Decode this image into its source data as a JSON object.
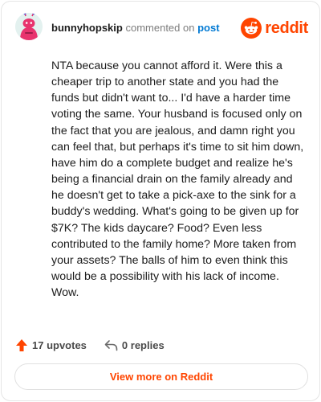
{
  "header": {
    "username": "bunnyhopskip",
    "action_text": "commented on",
    "post_link": "post",
    "logo_text": "reddit"
  },
  "comment": {
    "body": "NTA because you cannot afford it. Were this a cheaper trip to another state and you had the funds but didn't want to... I'd have a harder time voting the same. Your husband is focused only on the fact that you are jealous, and damn right you can feel that, but perhaps it's time to sit him down, have him do a complete budget and realize he's being a financial drain on the family already and he doesn't get to take a pick-axe to the sink for a buddy's wedding. What's going to be given up for $7K? The kids daycare? Food? Even less contributed to the family home? More taken from your assets? The balls of him to even think this would be a possibility with his lack of income. Wow."
  },
  "stats": {
    "upvotes": "17 upvotes",
    "replies": "0 replies"
  },
  "footer": {
    "view_more_label": "View more on Reddit"
  },
  "icons": {
    "avatar": "snoo-avatar-icon",
    "logo": "reddit-logo-icon",
    "upvote": "upvote-arrow-icon",
    "reply": "reply-arrow-icon"
  },
  "colors": {
    "brand": "#ff4500",
    "link": "#0079d3",
    "avatar_bg": "#e3f1ef",
    "avatar_body": "#e8336e",
    "text": "#1c1c1c",
    "muted": "#7c7c7c"
  }
}
